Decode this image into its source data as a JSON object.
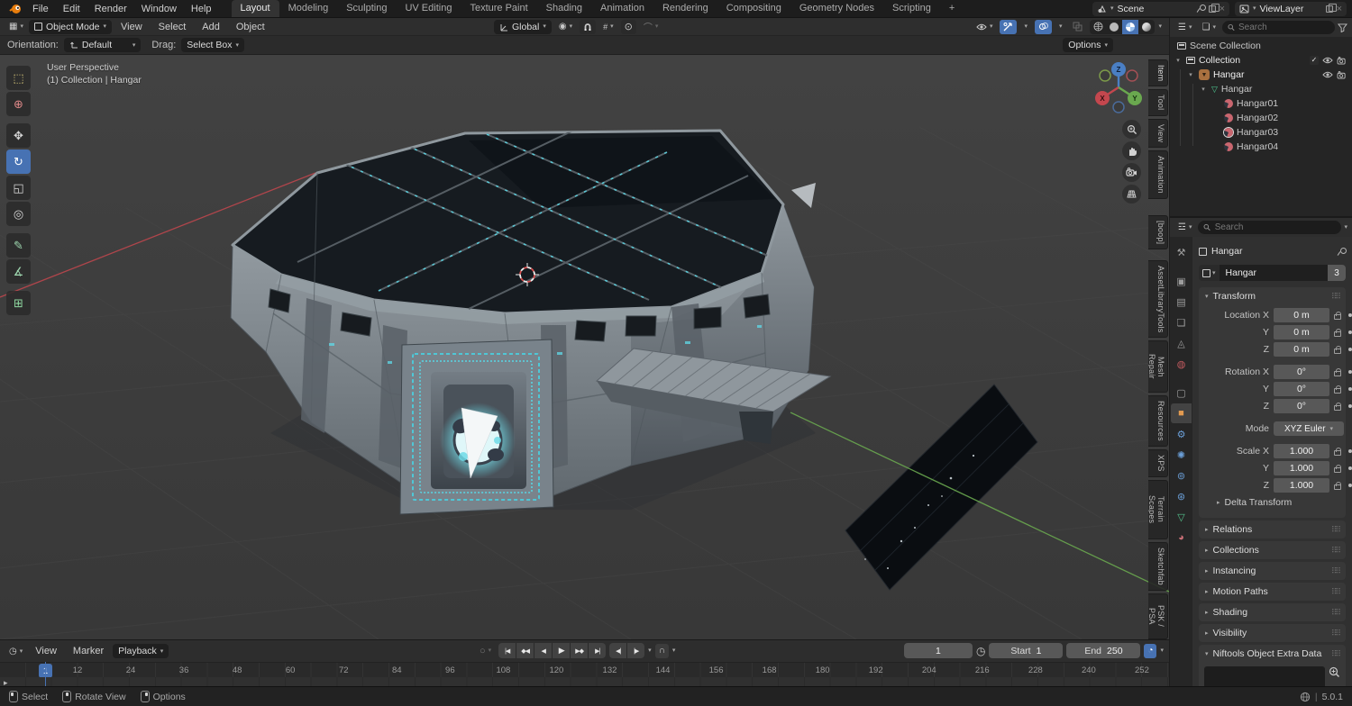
{
  "topbar": {
    "menus": [
      "File",
      "Edit",
      "Render",
      "Window",
      "Help"
    ],
    "workspaces": [
      "Layout",
      "Modeling",
      "Sculpting",
      "UV Editing",
      "Texture Paint",
      "Shading",
      "Animation",
      "Rendering",
      "Compositing",
      "Geometry Nodes",
      "Scripting",
      "+"
    ],
    "scene_label": "Scene",
    "viewlayer_label": "ViewLayer"
  },
  "viewport_header": {
    "mode": "Object Mode",
    "menus": [
      "View",
      "Select",
      "Add",
      "Object"
    ],
    "orientation": "Global"
  },
  "tool_settings": {
    "orientation_label": "Orientation:",
    "orientation_value": "Default",
    "drag_label": "Drag:",
    "drag_value": "Select Box",
    "options": "Options"
  },
  "viewport": {
    "overlay": {
      "line1": "User Perspective",
      "line2": "(1) Collection | Hangar"
    },
    "gizmo": {
      "x": "X",
      "y": "Y",
      "z": "Z"
    },
    "sidebar_tabs": [
      "Item",
      "Tool",
      "View",
      "Animation",
      "[boop]",
      "AssetLibraryTools",
      "Mesh Repair",
      "Resources",
      "XPS",
      "Terrain Scapes",
      "Sketchfab",
      "PSK / PSA"
    ]
  },
  "outliner": {
    "search_placeholder": "Search",
    "rows": [
      {
        "label": "Scene Collection"
      },
      {
        "label": "Collection"
      },
      {
        "label": "Hangar"
      },
      {
        "label": "Hangar"
      },
      {
        "label": "Hangar01"
      },
      {
        "label": "Hangar02"
      },
      {
        "label": "Hangar03"
      },
      {
        "label": "Hangar04"
      }
    ]
  },
  "properties": {
    "search_placeholder": "Search",
    "breadcrumb": "Hangar",
    "name_value": "Hangar",
    "users_count": "3",
    "transform": {
      "title": "Transform",
      "location": [
        {
          "label": "Location X",
          "value": "0 m"
        },
        {
          "label": "Y",
          "value": "0 m"
        },
        {
          "label": "Z",
          "value": "0 m"
        }
      ],
      "rotation": [
        {
          "label": "Rotation X",
          "value": "0°"
        },
        {
          "label": "Y",
          "value": "0°"
        },
        {
          "label": "Z",
          "value": "0°"
        }
      ],
      "mode_label": "Mode",
      "mode_value": "XYZ Euler",
      "scale": [
        {
          "label": "Scale X",
          "value": "1.000"
        },
        {
          "label": "Y",
          "value": "1.000"
        },
        {
          "label": "Z",
          "value": "1.000"
        }
      ],
      "delta": "Delta Transform"
    },
    "collapsed_panels": [
      "Relations",
      "Collections",
      "Instancing",
      "Motion Paths",
      "Shading",
      "Visibility"
    ],
    "niftools_title": "Niftools Object Extra Data"
  },
  "timeline": {
    "menus": [
      "View",
      "Marker",
      "Playback"
    ],
    "current_frame": "1",
    "start_label": "Start",
    "start_value": "1",
    "end_label": "End",
    "end_value": "250",
    "ruler": [
      "12",
      "24",
      "36",
      "48",
      "60",
      "72",
      "84",
      "96",
      "108",
      "120",
      "132",
      "144",
      "156",
      "168",
      "180",
      "192",
      "204",
      "216",
      "228",
      "240",
      "252"
    ]
  },
  "statusbar": {
    "items": [
      "Select",
      "Rotate View",
      "Options"
    ],
    "divider": "|",
    "version": "5.0.1"
  },
  "colors": {
    "accent": "#4772b3",
    "object_active": "#e29a50",
    "axis_x": "#c4474e",
    "axis_y": "#6aa84f",
    "axis_z": "#4a7fc4",
    "cyan_glow": "#5fd9e8"
  },
  "icons": {
    "caret": "▾",
    "caret_closed": "▸",
    "check": "✓",
    "close": "×",
    "grip": "⠿⠿",
    "editor_viewport": "▦",
    "editor_timeline": "◷",
    "editor_outliner": "☰",
    "editor_properties": "☲",
    "tab_tool": "⚒",
    "tab_render": "▣",
    "tab_output": "▤",
    "tab_viewlayer": "❏",
    "tab_scene": "◬",
    "tab_world": "◍",
    "tab_collection": "▢",
    "tab_object": "■",
    "tab_modifiers": "⚙",
    "tab_particles": "✺",
    "tab_physics": "⊚",
    "tab_constraints": "⊛",
    "tab_data": "▽",
    "tab_material": "◕",
    "record": "○",
    "jump_start": "|◀",
    "prev_key": "◆◀",
    "play_rev": "◀",
    "play": "▶",
    "next_key": "▶◆",
    "jump_end": "▶|",
    "step_back": "◀|",
    "step_fwd": "|▶",
    "keying": "∩",
    "stopwatch": "◷",
    "sync": "◔",
    "pivot": "◉",
    "snap_incr": "#",
    "prop_edit": "⊙",
    "falloff": "⌒",
    "object_tri": "▼",
    "mesh_data": "▽",
    "select_box_tool": "⬚",
    "cursor_tool": "⊕",
    "move_tool": "✥",
    "rotate_tool": "↻",
    "scale_tool": "◱",
    "transform_tool": "◎",
    "annotate_tool": "✎",
    "measure_tool": "∡",
    "addcube_tool": "⊞"
  }
}
